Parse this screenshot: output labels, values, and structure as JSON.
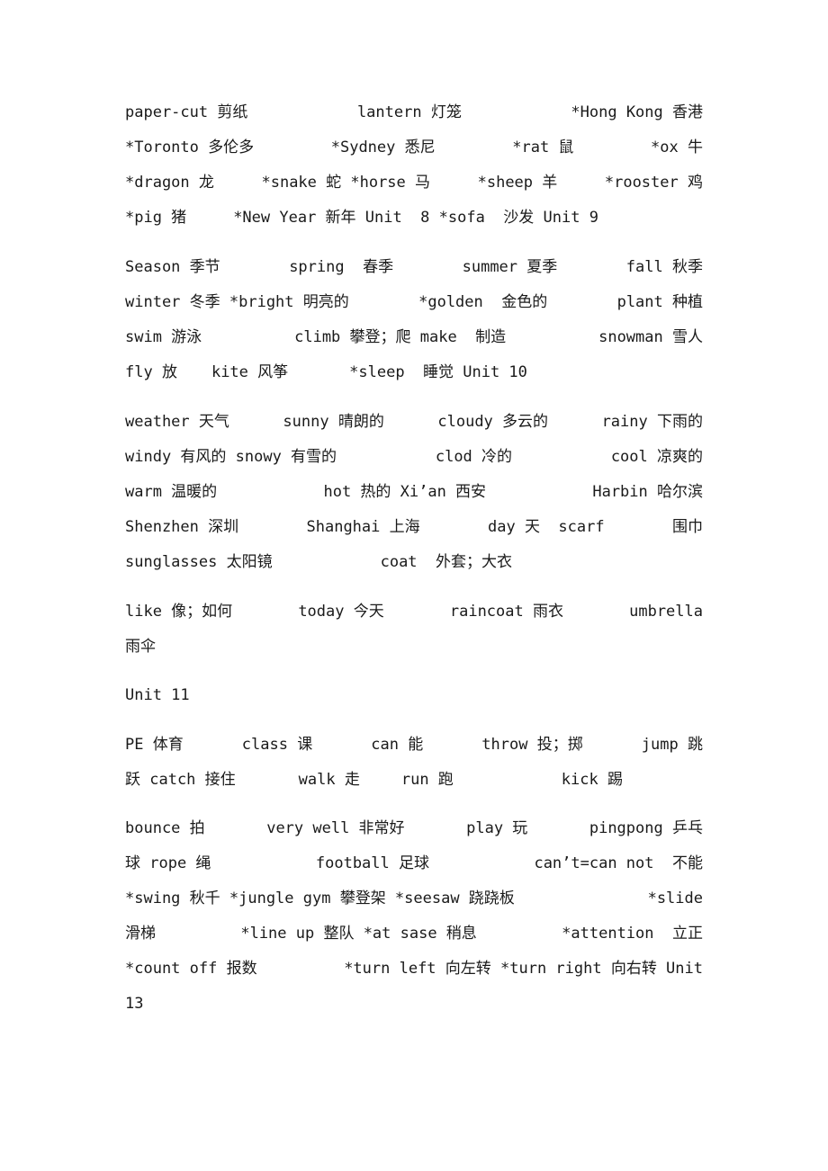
{
  "document": {
    "paragraphs": [
      {
        "lines": [
          [
            "paper-cut 剪纸",
            "lantern 灯笼",
            "*Hong Kong 香港"
          ],
          [
            "*Toronto 多伦多",
            "*Sydney 悉尼",
            "*rat 鼠",
            "*ox 牛"
          ],
          [
            "*dragon 龙",
            "*snake 蛇 *horse 马",
            "*sheep 羊",
            "*rooster 鸡"
          ],
          [
            "*pig 猪",
            "*New Year 新年 Unit  8 *sofa  沙发 Unit 9"
          ]
        ]
      },
      {
        "lines": [
          [
            "Season 季节",
            "spring  春季",
            "summer 夏季",
            "fall 秋季"
          ],
          [
            "winter 冬季 *bright 明亮的",
            "*golden  金色的",
            "plant 种植"
          ],
          [
            "swim 游泳",
            "climb 攀登；爬 make  制造",
            "snowman 雪人"
          ],
          [
            "fly 放",
            "kite 风筝",
            "*sleep  睡觉 Unit 10"
          ]
        ]
      },
      {
        "lines": [
          [
            "weather 天气",
            "sunny 晴朗的",
            "cloudy 多云的",
            "rainy 下雨的"
          ],
          [
            "windy 有风的 snowy 有雪的",
            "clod 冷的",
            "cool 凉爽的"
          ],
          [
            "warm 温暖的",
            "hot 热的 Xi’an 西安",
            "Harbin 哈尔滨"
          ],
          [
            "Shenzhen 深圳",
            "Shanghai 上海",
            "day 天  scarf",
            "围巾"
          ],
          [
            "sunglasses 太阳镜",
            "coat  外套；大衣"
          ]
        ]
      },
      {
        "lines": [
          [
            "like 像；如何",
            "today 今天",
            "raincoat 雨衣",
            "umbrella"
          ],
          [
            "雨伞"
          ]
        ]
      },
      {
        "lines": [
          [
            "Unit 11"
          ]
        ]
      },
      {
        "lines": [
          [
            "PE 体育",
            "class 课",
            "can 能",
            "throw 投；掷",
            "jump 跳"
          ],
          [
            "跃 catch 接住",
            "walk 走",
            "run 跑",
            "kick 踢"
          ]
        ]
      },
      {
        "lines": [
          [
            "bounce 拍",
            "very well 非常好",
            "play 玩",
            "pingpong 乒乓"
          ],
          [
            "球 rope 绳",
            "football 足球",
            "can’t=can not  不能"
          ],
          [
            "*swing 秋千 *jungle gym 攀登架 *seesaw 跷跷板",
            "*slide"
          ],
          [
            "滑梯",
            "*line up 整队 *at sase 稍息",
            "*attention  立正"
          ],
          [
            "*count off 报数",
            "*turn left 向左转 *turn right 向右转 Unit"
          ],
          [
            "13"
          ]
        ]
      }
    ]
  }
}
